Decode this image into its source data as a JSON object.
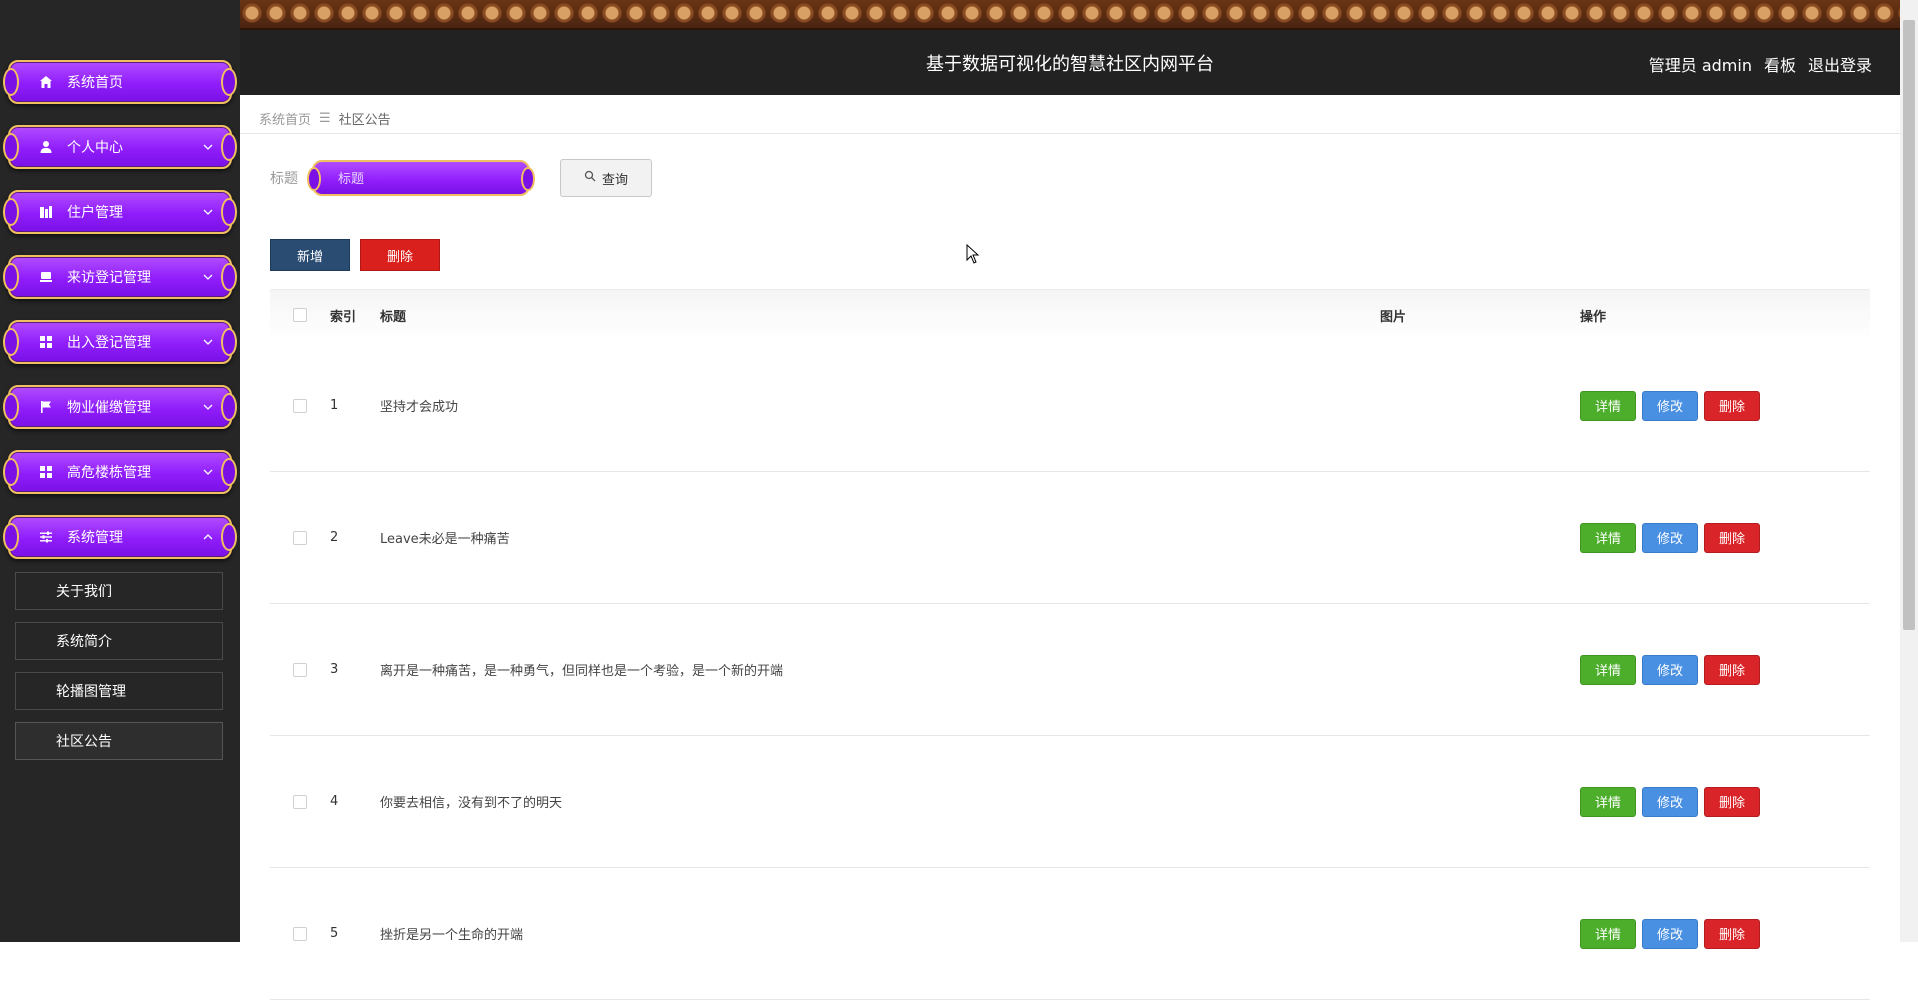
{
  "header": {
    "title": "基于数据可视化的智慧社区内网平台",
    "user_label": "管理员 admin",
    "dashboard_link": "看板",
    "logout_link": "退出登录"
  },
  "sidebar": {
    "items": [
      {
        "label": "系统首页",
        "icon": "home-icon"
      },
      {
        "label": "个人中心",
        "icon": "user-icon"
      },
      {
        "label": "住户管理",
        "icon": "building-icon"
      },
      {
        "label": "来访登记管理",
        "icon": "monitor-icon"
      },
      {
        "label": "出入登记管理",
        "icon": "grid-icon"
      },
      {
        "label": "物业催缴管理",
        "icon": "flag-icon"
      },
      {
        "label": "高危楼栋管理",
        "icon": "grid-icon"
      },
      {
        "label": "系统管理",
        "icon": "sliders-icon"
      }
    ],
    "submenu": [
      "关于我们",
      "系统简介",
      "轮播图管理",
      "社区公告"
    ]
  },
  "breadcrumb": {
    "home": "系统首页",
    "separator": "☰",
    "current": "社区公告"
  },
  "search": {
    "label": "标题",
    "placeholder": "标题",
    "button": "查询"
  },
  "actions": {
    "add": "新增",
    "delete": "删除"
  },
  "table": {
    "headers": {
      "index": "索引",
      "title": "标题",
      "image": "图片",
      "ops": "操作"
    },
    "rows": [
      {
        "index": "1",
        "title": "坚持才会成功"
      },
      {
        "index": "2",
        "title": "Leave未必是一种痛苦"
      },
      {
        "index": "3",
        "title": "离开是一种痛苦，是一种勇气，但同样也是一个考验，是一个新的开端"
      },
      {
        "index": "4",
        "title": "你要去相信，没有到不了的明天"
      },
      {
        "index": "5",
        "title": "挫折是另一个生命的开端"
      }
    ],
    "op_labels": {
      "detail": "详情",
      "edit": "修改",
      "delete": "删除"
    }
  },
  "colors": {
    "menu_purple": "#8f1dfb",
    "menu_gold_border": "#f0c060",
    "sidebar_bg": "#262626",
    "header_bg": "#222222",
    "btn_add": "#2a4b72",
    "btn_del": "#d9201d",
    "op_detail": "#4cae2a",
    "op_edit": "#4a90e2",
    "op_delete": "#d9252a"
  }
}
